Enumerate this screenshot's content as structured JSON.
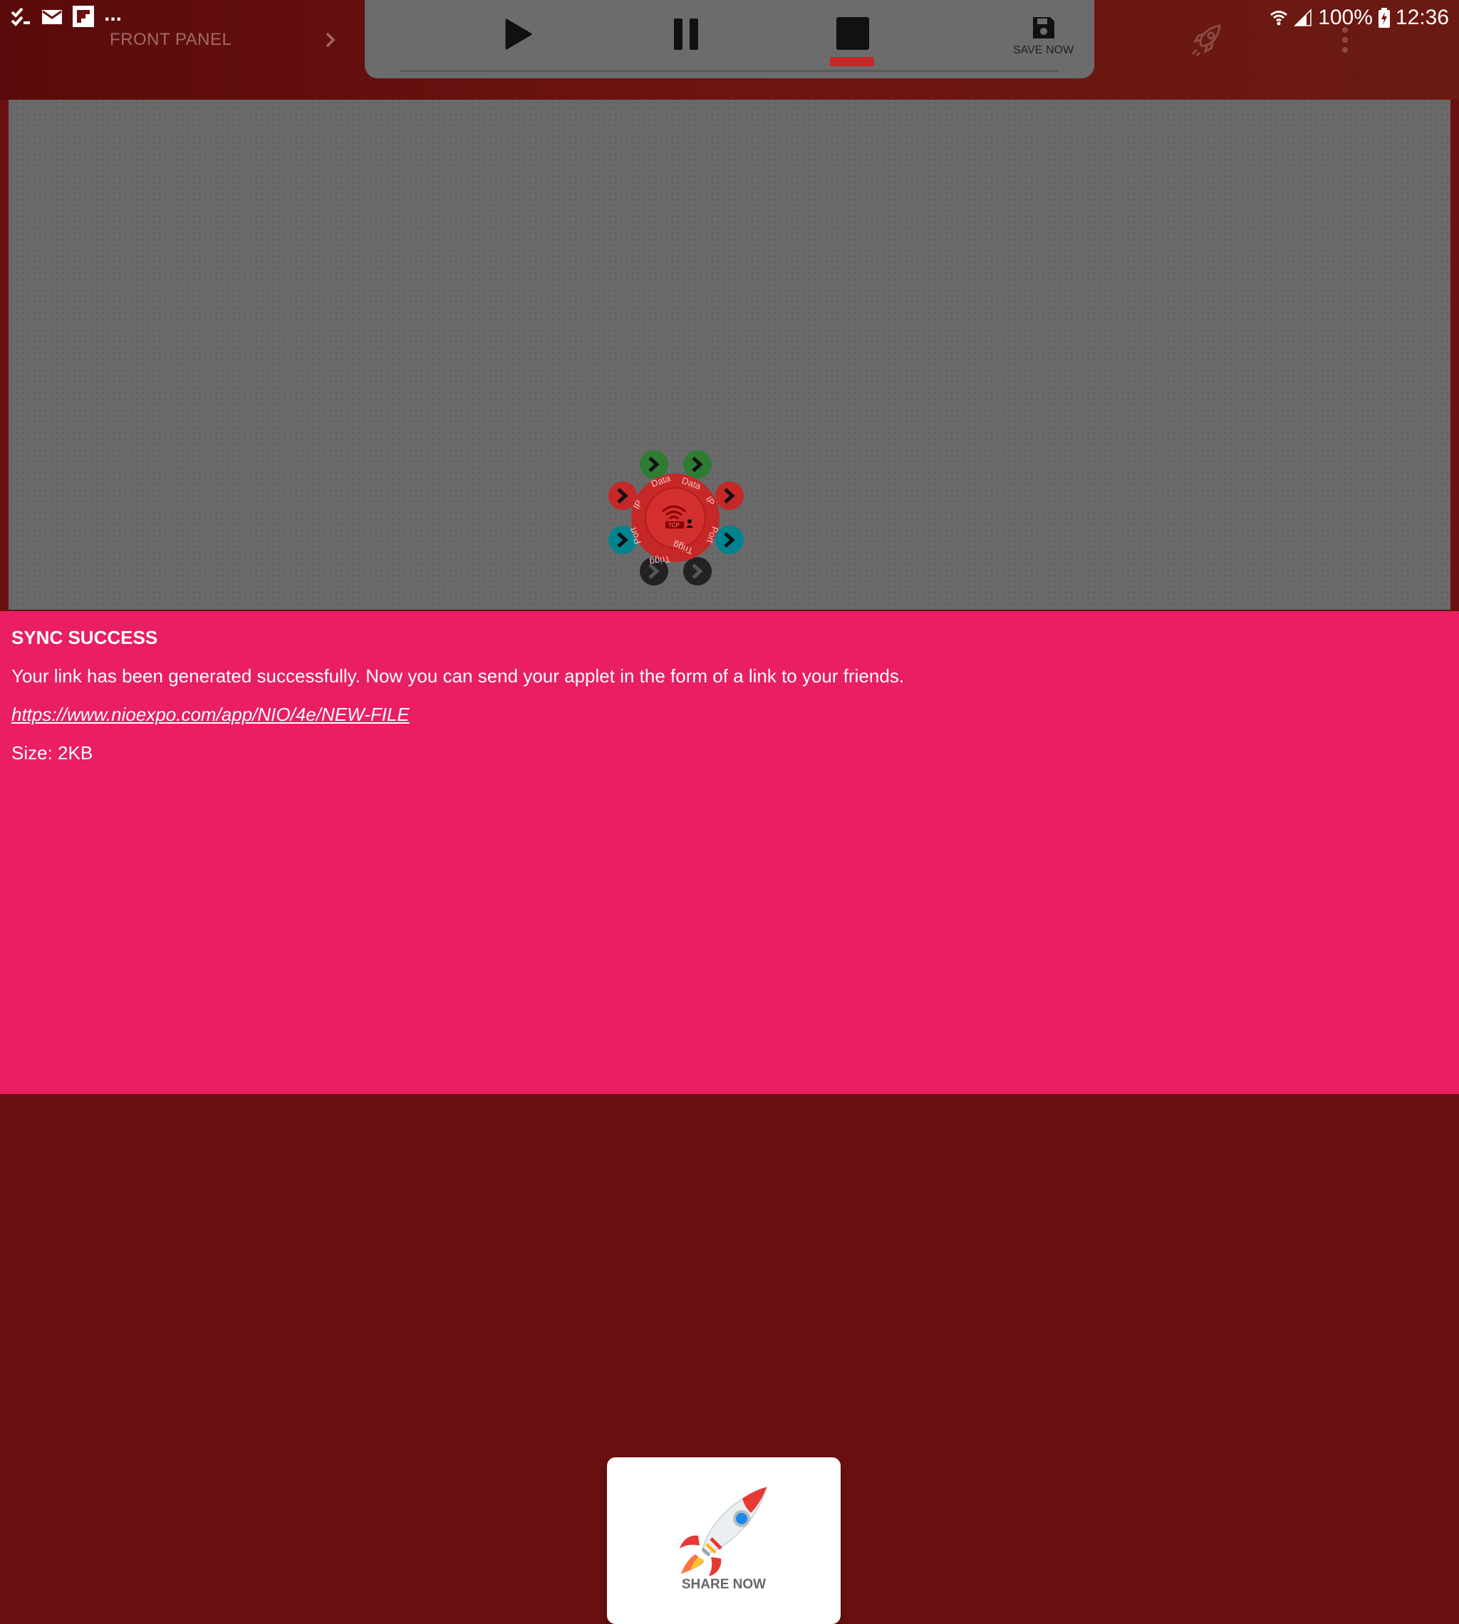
{
  "status_bar": {
    "overflow": "...",
    "battery": "100%",
    "time": "12:36"
  },
  "header": {
    "front_panel_label": "FRONT PANEL",
    "save_label": "SAVE NOW"
  },
  "canvas": {
    "node_labels": [
      "Data",
      "Data",
      "IP",
      "IP",
      "Port",
      "Port",
      "Trigg",
      "Trigg"
    ],
    "node_badge": "TCP"
  },
  "sync": {
    "title": "SYNC SUCCESS",
    "message": "Your link has been generated successfully. Now you can send your applet in the form of a link to your friends.",
    "link": "https://www.nioexpo.com/app/NIO/4e/NEW-FILE",
    "size": "Size: 2KB",
    "share_label": "SHARE NOW"
  },
  "colors": {
    "accent": "#e91e63",
    "header": "#6e1512",
    "canvas": "#6a6a6a",
    "stop_indicator": "#c62828"
  }
}
